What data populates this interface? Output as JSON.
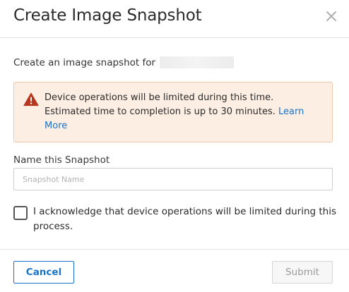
{
  "dialog": {
    "title": "Create Image Snapshot",
    "close_icon": "close-icon"
  },
  "intro": {
    "text": "Create an image snapshot for"
  },
  "warning": {
    "icon": "warning-triangle-icon",
    "line1": "Device operations will be limited during this time.",
    "line2": "Estimated time to completion is up to 30 minutes. ",
    "link": "Learn More",
    "colors": {
      "background": "#fdeee3",
      "border": "#efc7a9",
      "icon": "#b5381e",
      "link": "#1a73c7"
    }
  },
  "snapshot_name": {
    "label": "Name this Snapshot",
    "placeholder": "Snapshot Name",
    "value": ""
  },
  "acknowledge": {
    "checked": false,
    "label": "I acknowledge that device operations will be limited during this process."
  },
  "footer": {
    "cancel_label": "Cancel",
    "submit_label": "Submit",
    "submit_disabled": true
  }
}
